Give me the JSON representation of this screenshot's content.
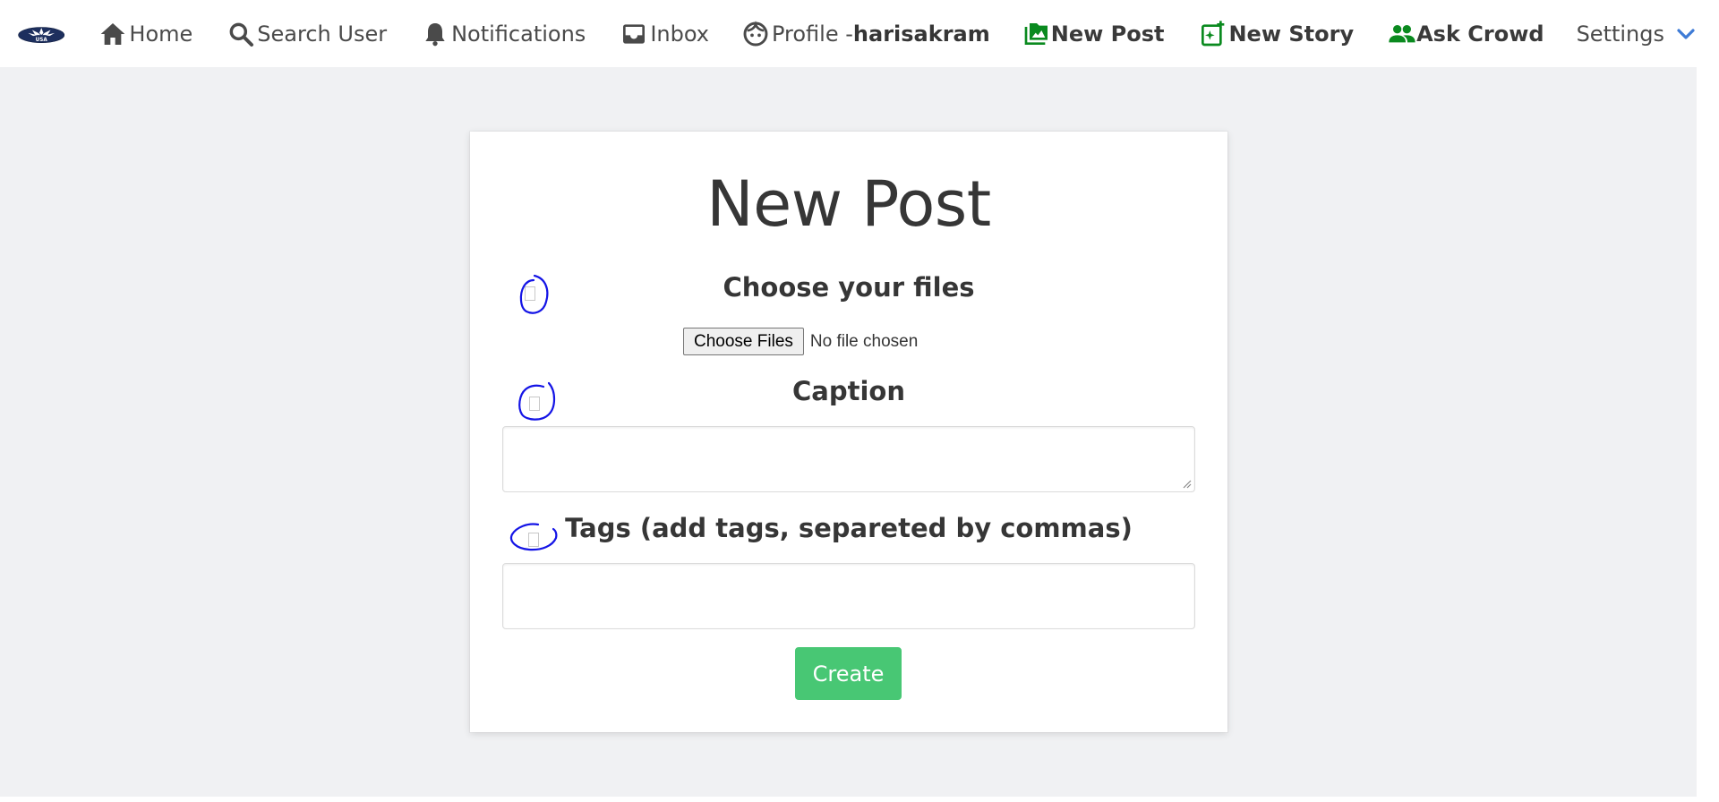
{
  "nav": {
    "logo_text": "USA",
    "home": "Home",
    "search": "Search User",
    "notifications": "Notifications",
    "inbox": "Inbox",
    "profile_prefix": "Profile -",
    "profile_user": "harisakram",
    "new_post": "New Post",
    "new_story": "New Story",
    "ask_crowd": "Ask Crowd",
    "settings": "Settings"
  },
  "colors": {
    "accent_green": "#0a8a1f",
    "create_button": "#48c774",
    "chevron_blue": "#3e7bd6",
    "annotation_blue": "#1414e6"
  },
  "form": {
    "title": "New Post",
    "files_label": "Choose your files",
    "files_button": "Choose Files",
    "files_status": "No file chosen",
    "caption_label": "Caption",
    "caption_value": "",
    "tags_label": "Tags (add tags, separeted by commas)",
    "tags_value": "",
    "submit": "Create"
  }
}
